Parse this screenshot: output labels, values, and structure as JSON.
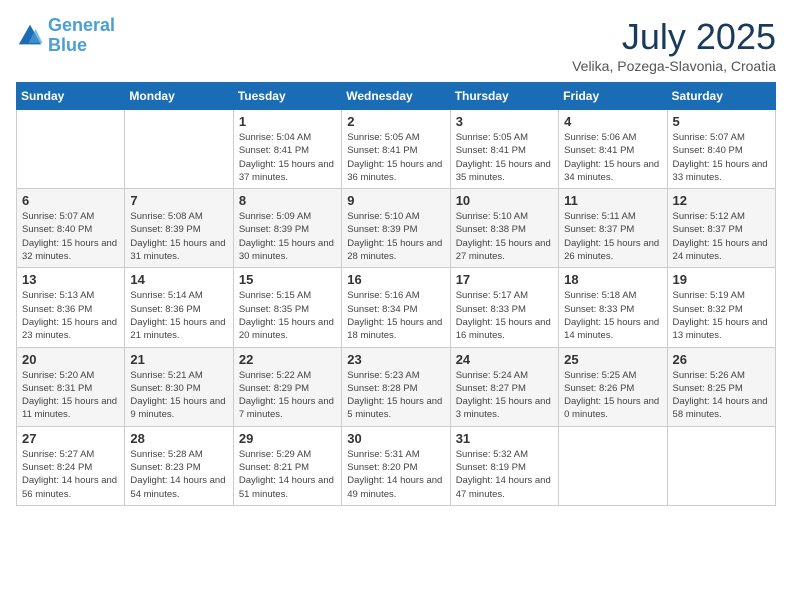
{
  "header": {
    "logo_line1": "General",
    "logo_line2": "Blue",
    "month": "July 2025",
    "location": "Velika, Pozega-Slavonia, Croatia"
  },
  "weekdays": [
    "Sunday",
    "Monday",
    "Tuesday",
    "Wednesday",
    "Thursday",
    "Friday",
    "Saturday"
  ],
  "weeks": [
    [
      {
        "day": "",
        "info": ""
      },
      {
        "day": "",
        "info": ""
      },
      {
        "day": "1",
        "info": "Sunrise: 5:04 AM\nSunset: 8:41 PM\nDaylight: 15 hours and 37 minutes."
      },
      {
        "day": "2",
        "info": "Sunrise: 5:05 AM\nSunset: 8:41 PM\nDaylight: 15 hours and 36 minutes."
      },
      {
        "day": "3",
        "info": "Sunrise: 5:05 AM\nSunset: 8:41 PM\nDaylight: 15 hours and 35 minutes."
      },
      {
        "day": "4",
        "info": "Sunrise: 5:06 AM\nSunset: 8:41 PM\nDaylight: 15 hours and 34 minutes."
      },
      {
        "day": "5",
        "info": "Sunrise: 5:07 AM\nSunset: 8:40 PM\nDaylight: 15 hours and 33 minutes."
      }
    ],
    [
      {
        "day": "6",
        "info": "Sunrise: 5:07 AM\nSunset: 8:40 PM\nDaylight: 15 hours and 32 minutes."
      },
      {
        "day": "7",
        "info": "Sunrise: 5:08 AM\nSunset: 8:39 PM\nDaylight: 15 hours and 31 minutes."
      },
      {
        "day": "8",
        "info": "Sunrise: 5:09 AM\nSunset: 8:39 PM\nDaylight: 15 hours and 30 minutes."
      },
      {
        "day": "9",
        "info": "Sunrise: 5:10 AM\nSunset: 8:39 PM\nDaylight: 15 hours and 28 minutes."
      },
      {
        "day": "10",
        "info": "Sunrise: 5:10 AM\nSunset: 8:38 PM\nDaylight: 15 hours and 27 minutes."
      },
      {
        "day": "11",
        "info": "Sunrise: 5:11 AM\nSunset: 8:37 PM\nDaylight: 15 hours and 26 minutes."
      },
      {
        "day": "12",
        "info": "Sunrise: 5:12 AM\nSunset: 8:37 PM\nDaylight: 15 hours and 24 minutes."
      }
    ],
    [
      {
        "day": "13",
        "info": "Sunrise: 5:13 AM\nSunset: 8:36 PM\nDaylight: 15 hours and 23 minutes."
      },
      {
        "day": "14",
        "info": "Sunrise: 5:14 AM\nSunset: 8:36 PM\nDaylight: 15 hours and 21 minutes."
      },
      {
        "day": "15",
        "info": "Sunrise: 5:15 AM\nSunset: 8:35 PM\nDaylight: 15 hours and 20 minutes."
      },
      {
        "day": "16",
        "info": "Sunrise: 5:16 AM\nSunset: 8:34 PM\nDaylight: 15 hours and 18 minutes."
      },
      {
        "day": "17",
        "info": "Sunrise: 5:17 AM\nSunset: 8:33 PM\nDaylight: 15 hours and 16 minutes."
      },
      {
        "day": "18",
        "info": "Sunrise: 5:18 AM\nSunset: 8:33 PM\nDaylight: 15 hours and 14 minutes."
      },
      {
        "day": "19",
        "info": "Sunrise: 5:19 AM\nSunset: 8:32 PM\nDaylight: 15 hours and 13 minutes."
      }
    ],
    [
      {
        "day": "20",
        "info": "Sunrise: 5:20 AM\nSunset: 8:31 PM\nDaylight: 15 hours and 11 minutes."
      },
      {
        "day": "21",
        "info": "Sunrise: 5:21 AM\nSunset: 8:30 PM\nDaylight: 15 hours and 9 minutes."
      },
      {
        "day": "22",
        "info": "Sunrise: 5:22 AM\nSunset: 8:29 PM\nDaylight: 15 hours and 7 minutes."
      },
      {
        "day": "23",
        "info": "Sunrise: 5:23 AM\nSunset: 8:28 PM\nDaylight: 15 hours and 5 minutes."
      },
      {
        "day": "24",
        "info": "Sunrise: 5:24 AM\nSunset: 8:27 PM\nDaylight: 15 hours and 3 minutes."
      },
      {
        "day": "25",
        "info": "Sunrise: 5:25 AM\nSunset: 8:26 PM\nDaylight: 15 hours and 0 minutes."
      },
      {
        "day": "26",
        "info": "Sunrise: 5:26 AM\nSunset: 8:25 PM\nDaylight: 14 hours and 58 minutes."
      }
    ],
    [
      {
        "day": "27",
        "info": "Sunrise: 5:27 AM\nSunset: 8:24 PM\nDaylight: 14 hours and 56 minutes."
      },
      {
        "day": "28",
        "info": "Sunrise: 5:28 AM\nSunset: 8:23 PM\nDaylight: 14 hours and 54 minutes."
      },
      {
        "day": "29",
        "info": "Sunrise: 5:29 AM\nSunset: 8:21 PM\nDaylight: 14 hours and 51 minutes."
      },
      {
        "day": "30",
        "info": "Sunrise: 5:31 AM\nSunset: 8:20 PM\nDaylight: 14 hours and 49 minutes."
      },
      {
        "day": "31",
        "info": "Sunrise: 5:32 AM\nSunset: 8:19 PM\nDaylight: 14 hours and 47 minutes."
      },
      {
        "day": "",
        "info": ""
      },
      {
        "day": "",
        "info": ""
      }
    ]
  ]
}
